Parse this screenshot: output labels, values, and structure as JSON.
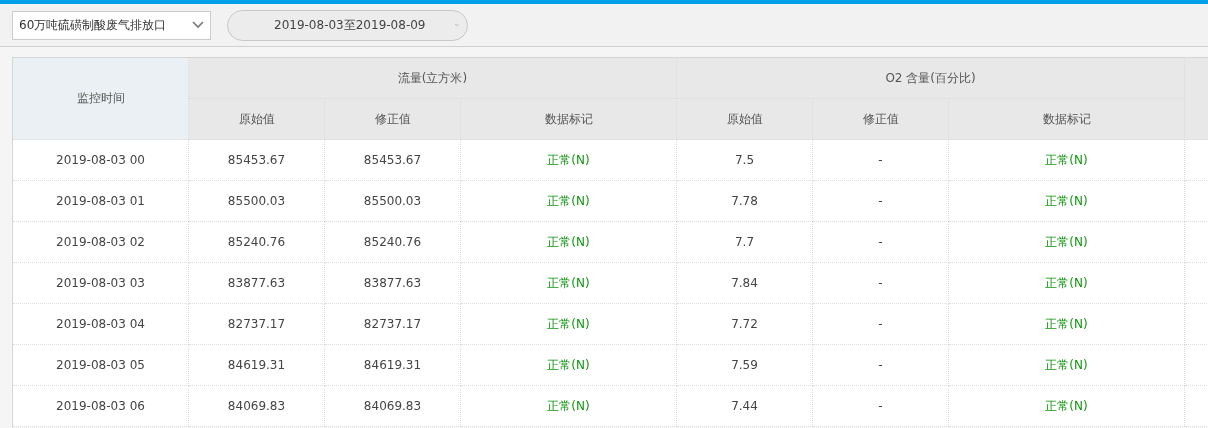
{
  "toolbar": {
    "outlet_select": {
      "value": "60万吨硫磺制酸废气排放口"
    },
    "date_range": {
      "value": "2019-08-03至2019-08-09"
    }
  },
  "table": {
    "time_column": "监控时间",
    "groups": [
      {
        "label": "流量(立方米)",
        "columns": [
          "原始值",
          "修正值",
          "数据标记"
        ]
      },
      {
        "label": "O2 含量(百分比)",
        "columns": [
          "原始值",
          "修正值",
          "数据标记"
        ]
      }
    ],
    "rows": [
      {
        "time": "2019-08-03 00",
        "cells": [
          "85453.67",
          "85453.67",
          "正常(N)",
          "7.5",
          "-",
          "正常(N)"
        ]
      },
      {
        "time": "2019-08-03 01",
        "cells": [
          "85500.03",
          "85500.03",
          "正常(N)",
          "7.78",
          "-",
          "正常(N)"
        ]
      },
      {
        "time": "2019-08-03 02",
        "cells": [
          "85240.76",
          "85240.76",
          "正常(N)",
          "7.7",
          "-",
          "正常(N)"
        ]
      },
      {
        "time": "2019-08-03 03",
        "cells": [
          "83877.63",
          "83877.63",
          "正常(N)",
          "7.84",
          "-",
          "正常(N)"
        ]
      },
      {
        "time": "2019-08-03 04",
        "cells": [
          "82737.17",
          "82737.17",
          "正常(N)",
          "7.72",
          "-",
          "正常(N)"
        ]
      },
      {
        "time": "2019-08-03 05",
        "cells": [
          "84619.31",
          "84619.31",
          "正常(N)",
          "7.59",
          "-",
          "正常(N)"
        ]
      },
      {
        "time": "2019-08-03 06",
        "cells": [
          "84069.83",
          "84069.83",
          "正常(N)",
          "7.44",
          "-",
          "正常(N)"
        ]
      }
    ]
  }
}
